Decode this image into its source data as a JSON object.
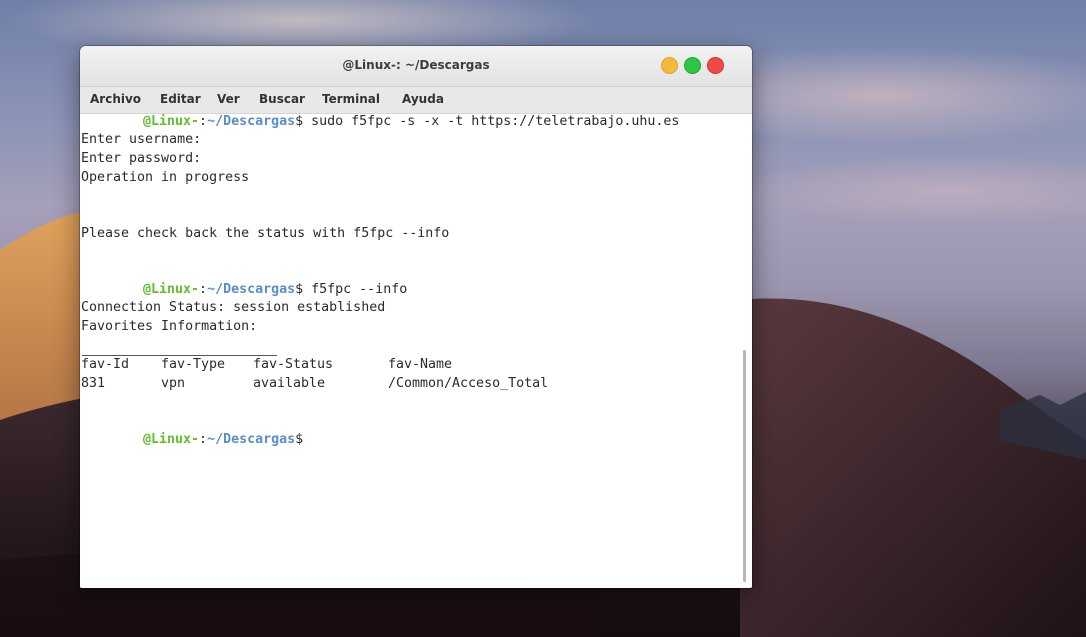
{
  "window": {
    "title": "@Linux-: ~/Descargas"
  },
  "menu": [
    "Archivo",
    "Editar",
    "Ver",
    "Buscar",
    "Terminal",
    "Ayuda"
  ],
  "prompt": {
    "user": "@Linux-",
    "sep": ":",
    "path": "~/Descargas",
    "symbol": "$"
  },
  "terminal": {
    "cmd1": " sudo f5fpc -s -x -t https://teletrabajo.uhu.es",
    "out1": "Enter username:",
    "out2": "Enter password:",
    "out3": "Operation in progress",
    "out4": "Please check back the status with f5fpc --info",
    "cmd2": " f5fpc --info",
    "out5": "Connection Status: session established",
    "out6": "Favorites Information:",
    "table": {
      "headers": [
        "fav-Id",
        "fav-Type",
        "fav-Status",
        "fav-Name"
      ],
      "rows": [
        [
          "831",
          "vpn",
          "available",
          "/Common/Acceso_Total"
        ]
      ]
    }
  },
  "colors": {
    "prompt_user": "#5fbf2f",
    "prompt_path": "#5a8dc8",
    "btn_close": "#ef4a4a",
    "btn_min": "#f5b93b",
    "btn_max": "#2dc641"
  }
}
